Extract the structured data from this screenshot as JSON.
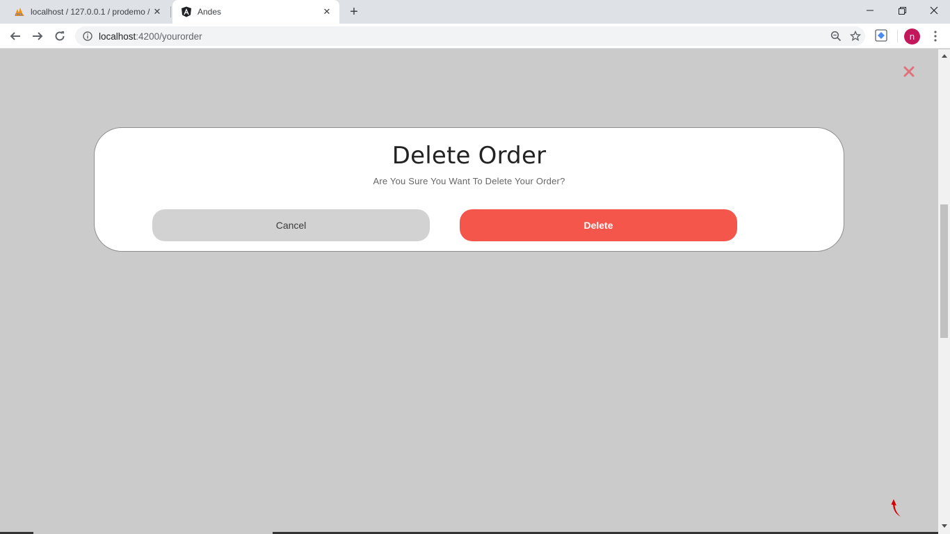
{
  "browser": {
    "tabs": [
      {
        "title": "localhost / 127.0.0.1 / prodemo /",
        "favicon": "phpmyadmin-icon",
        "active": false
      },
      {
        "title": "Andes",
        "favicon": "angular-icon",
        "active": true
      }
    ],
    "url_host": "localhost",
    "url_path": ":4200/yourorder",
    "profile_initial": "n",
    "colors": {
      "tab_strip": "#dee1e6",
      "avatar": "#c2185b"
    }
  },
  "page": {
    "background": "#cbcbcb",
    "close_icon": "close-x-icon",
    "close_color": "#e0707c",
    "scroll_top_icon": "red-arrow-up-icon"
  },
  "modal": {
    "title": "Delete Order",
    "message": "Are You Sure You Want To Delete Your Order?",
    "cancel_label": "Cancel",
    "delete_label": "Delete",
    "colors": {
      "cancel_bg": "#d2d2d2",
      "delete_bg": "#f4564b"
    }
  }
}
